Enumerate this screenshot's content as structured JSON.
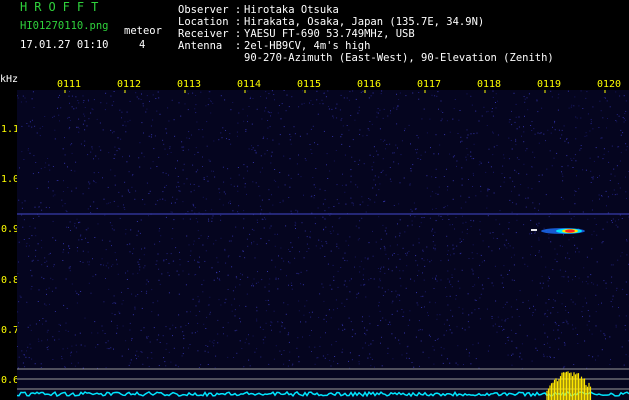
{
  "header": {
    "logo": "HROFFT",
    "filename": "HI01270110.png",
    "datetime": "17.01.27 01:10",
    "meteor_label": "meteor",
    "meteor_count": "4"
  },
  "station": {
    "observer_key": "Observer :",
    "observer": "Hirotaka Otsuka",
    "location_key": "Location :",
    "location": "Hirakata, Osaka, Japan (135.7E, 34.9N)",
    "receiver_key": "Receiver :",
    "receiver": "YAESU FT-690 53.749MHz, USB",
    "antenna_key": "Antenna  :",
    "antenna_line1": "2el-HB9CV, 4m's high",
    "antenna_line2": "90-270-Azimuth (East-West), 90-Elevation (Zenith)"
  },
  "axes": {
    "y_unit": "kHz",
    "y_ticks": [
      "1.1",
      "1.0",
      "0.9",
      "0.8",
      "0.7",
      "0.6"
    ],
    "x_ticks": [
      "0111",
      "0112",
      "0113",
      "0114",
      "0115",
      "0116",
      "0117",
      "0118",
      "0119",
      "0120"
    ]
  },
  "colors": {
    "background": "#05051f",
    "header_green": "#2fd23c",
    "tick_yellow": "#ffff00",
    "signal_cyan": "#00e5ff",
    "echo_red": "#ff2020"
  }
}
